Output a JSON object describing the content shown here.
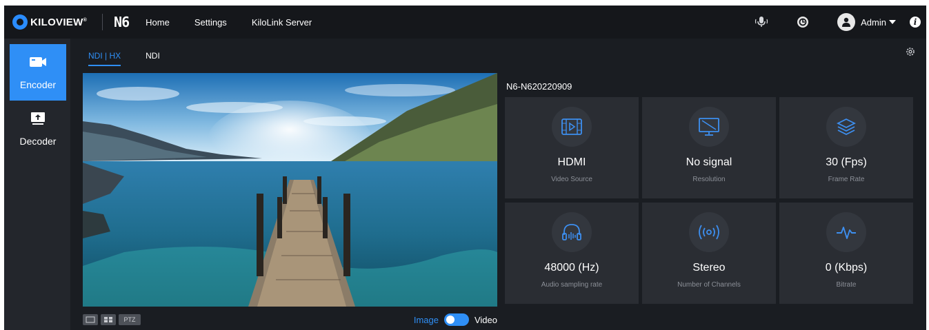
{
  "brand": {
    "name": "KILOVIEW",
    "reg": "®",
    "model": "N6"
  },
  "nav": {
    "items": [
      "Home",
      "Settings",
      "KiloLink Server"
    ]
  },
  "user": {
    "name": "Admin"
  },
  "sidebar": {
    "items": [
      {
        "label": "Encoder",
        "active": true
      },
      {
        "label": "Decoder",
        "active": false
      }
    ]
  },
  "tabs": [
    {
      "label": "NDI | HX",
      "active": true
    },
    {
      "label": "NDI",
      "active": false
    }
  ],
  "preview": {
    "ptz_label": "PTZ",
    "toggle_left": "Image",
    "toggle_right": "Video"
  },
  "device": {
    "name": "N6-N620220909"
  },
  "stats": [
    {
      "value": "HDMI",
      "label": "Video Source",
      "icon": "video-source-icon"
    },
    {
      "value": "No signal",
      "label": "Resolution",
      "icon": "resolution-icon"
    },
    {
      "value": "30  (Fps)",
      "label": "Frame Rate",
      "icon": "frame-rate-icon"
    },
    {
      "value": "48000  (Hz)",
      "label": "Audio sampling rate",
      "icon": "audio-icon"
    },
    {
      "value": "Stereo",
      "label": "Number of Channels",
      "icon": "channels-icon"
    },
    {
      "value": "0  (Kbps)",
      "label": "Bitrate",
      "icon": "bitrate-icon"
    }
  ],
  "colors": {
    "accent": "#2f8ff6",
    "background": "#1a1d22",
    "card": "#2a2d33"
  }
}
